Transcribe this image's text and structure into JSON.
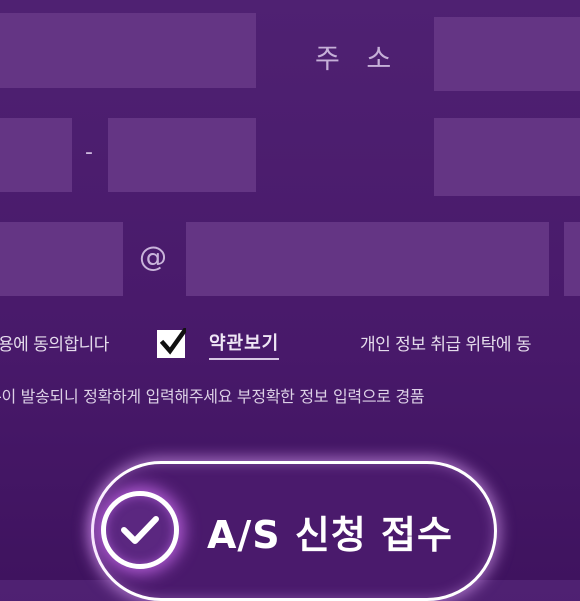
{
  "form": {
    "address_label": "주 소",
    "phone_separator": "-",
    "email_at": "@"
  },
  "consent": {
    "agree_text_left": "용에 동의합니다",
    "checkbox_checked": true,
    "terms_link": "약관보기",
    "agree_text_right": "개인 정보 취급 위탁에 동"
  },
  "notice_text": "-이 발송되니 정확하게 입력해주세요 부정확한 정보 입력으로 경품",
  "submit": {
    "label": "A/S 신청 접수",
    "icon": "check-circle-icon"
  },
  "colors": {
    "background": "#4b1c6d",
    "field": "#643584",
    "glow": "#e6aaff"
  }
}
